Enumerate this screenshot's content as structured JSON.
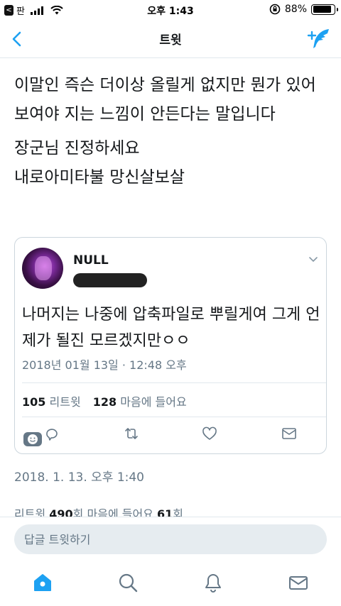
{
  "status_bar": {
    "back_app": "<",
    "carrier": "판",
    "time": "오후 1:43",
    "battery_percent": "88%",
    "battery_level": 0.88
  },
  "nav": {
    "title": "트윗"
  },
  "tweet": {
    "paragraphs": [
      "이말인 즉슨 더이상 올릴게 없지만 뭔가 있어보여야 지는 느낌이 안든다는 말입니다",
      "장군님 진정하세요\n내로아미타불 망신살보살"
    ],
    "date": "2018. 1. 13. 오후 1:40",
    "stats": {
      "retweet_label": "리트윗",
      "retweet_count": "490",
      "retweet_unit": "회",
      "likes_label": "마음에 들어요",
      "likes_count": "61",
      "likes_unit": "회"
    }
  },
  "quote": {
    "name": "NULL",
    "text": "나머지는 나중에 압축파일로 뿌릴게여 그게 언제가 될진 모르겠지만ㅇㅇ",
    "date": "2018년 01월 13일 · 12:48 오후",
    "retweet_count": "105",
    "retweet_label": "리트윗",
    "likes_count": "128",
    "likes_label": "마음에 들어요"
  },
  "reply": {
    "placeholder": "답글 트윗하기"
  },
  "colors": {
    "accent": "#1da1f2",
    "secondary_text": "#657786",
    "border": "#e1e8ed"
  },
  "icons": {
    "tabs": [
      "home-icon",
      "search-icon",
      "notifications-icon",
      "messages-icon"
    ],
    "quote_actions": [
      "reply-icon",
      "retweet-icon",
      "like-icon",
      "dm-icon"
    ]
  }
}
